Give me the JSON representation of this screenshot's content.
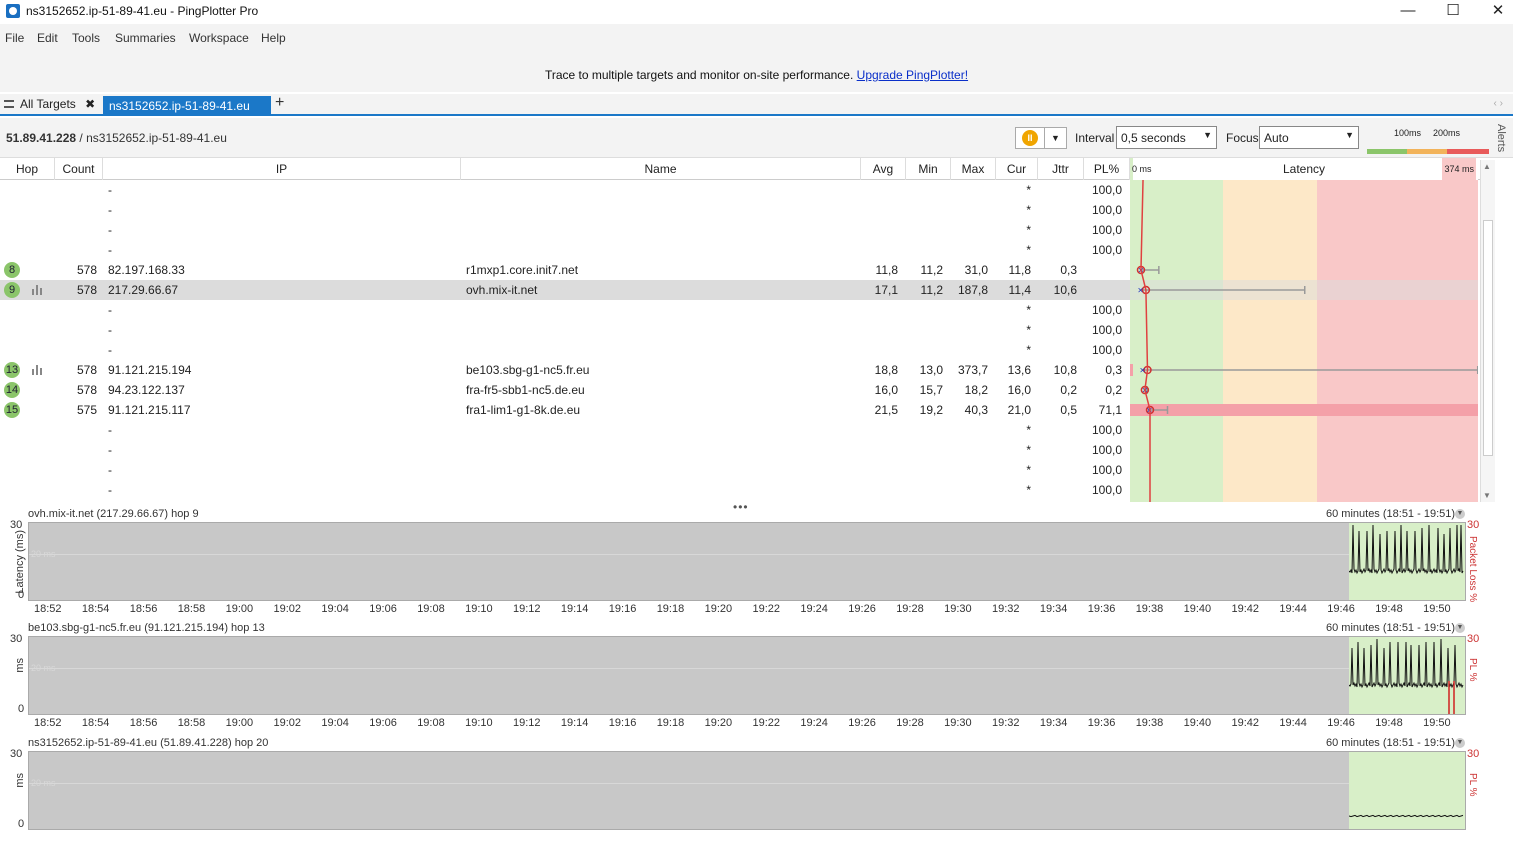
{
  "window": {
    "title": "ns3152652.ip-51-89-41.eu - PingPlotter Pro",
    "minimize": "—",
    "maximize": "☐",
    "close": "✕"
  },
  "menu": [
    "File",
    "Edit",
    "Tools",
    "Summaries",
    "Workspace",
    "Help"
  ],
  "banner": {
    "text": "Trace to multiple targets and monitor on-site performance.",
    "link": "Upgrade PingPlotter!"
  },
  "tabs": {
    "all": "All Targets",
    "active": "ns3152652.ip-51-89-41.eu",
    "add": "+"
  },
  "target": {
    "ip": "51.89.41.228",
    "host": "ns3152652.ip-51-89-41.eu",
    "interval_label": "Interval",
    "interval_value": "0,5 seconds",
    "focus_label": "Focus",
    "focus_value": "Auto",
    "scale_100": "100ms",
    "scale_200": "200ms",
    "alerts": "Alerts"
  },
  "table": {
    "headers": [
      "Hop",
      "Count",
      "IP",
      "Name",
      "Avg",
      "Min",
      "Max",
      "Cur",
      "Jttr",
      "PL%"
    ],
    "latency_header": "Latency",
    "lat_min": "0 ms",
    "lat_max": "374 ms",
    "rows": [
      {
        "hop": "",
        "count": "",
        "ip": "-",
        "name": "",
        "avg": "",
        "min": "",
        "max": "",
        "cur": "*",
        "jttr": "",
        "pl": "100,0"
      },
      {
        "hop": "",
        "count": "",
        "ip": "-",
        "name": "",
        "avg": "",
        "min": "",
        "max": "",
        "cur": "*",
        "jttr": "",
        "pl": "100,0"
      },
      {
        "hop": "",
        "count": "",
        "ip": "-",
        "name": "",
        "avg": "",
        "min": "",
        "max": "",
        "cur": "*",
        "jttr": "",
        "pl": "100,0"
      },
      {
        "hop": "",
        "count": "",
        "ip": "-",
        "name": "",
        "avg": "",
        "min": "",
        "max": "",
        "cur": "*",
        "jttr": "",
        "pl": "100,0"
      },
      {
        "hop": "8",
        "count": "578",
        "ip": "82.197.168.33",
        "name": "r1mxp1.core.init7.net",
        "avg": "11,8",
        "min": "11,2",
        "max": "31,0",
        "cur": "11,8",
        "jttr": "0,3",
        "pl": ""
      },
      {
        "hop": "9",
        "count": "578",
        "ip": "217.29.66.67",
        "name": "ovh.mix-it.net",
        "avg": "17,1",
        "min": "11,2",
        "max": "187,8",
        "cur": "11,4",
        "jttr": "10,6",
        "pl": ""
      },
      {
        "hop": "",
        "count": "",
        "ip": "-",
        "name": "",
        "avg": "",
        "min": "",
        "max": "",
        "cur": "*",
        "jttr": "",
        "pl": "100,0"
      },
      {
        "hop": "",
        "count": "",
        "ip": "-",
        "name": "",
        "avg": "",
        "min": "",
        "max": "",
        "cur": "*",
        "jttr": "",
        "pl": "100,0"
      },
      {
        "hop": "",
        "count": "",
        "ip": "-",
        "name": "",
        "avg": "",
        "min": "",
        "max": "",
        "cur": "*",
        "jttr": "",
        "pl": "100,0"
      },
      {
        "hop": "13",
        "count": "578",
        "ip": "91.121.215.194",
        "name": "be103.sbg-g1-nc5.fr.eu",
        "avg": "18,8",
        "min": "13,0",
        "max": "373,7",
        "cur": "13,6",
        "jttr": "10,8",
        "pl": "0,3"
      },
      {
        "hop": "14",
        "count": "578",
        "ip": "94.23.122.137",
        "name": "fra-fr5-sbb1-nc5.de.eu",
        "avg": "16,0",
        "min": "15,7",
        "max": "18,2",
        "cur": "16,0",
        "jttr": "0,2",
        "pl": "0,2"
      },
      {
        "hop": "15",
        "count": "575",
        "ip": "91.121.215.117",
        "name": "fra1-lim1-g1-8k.de.eu",
        "avg": "21,5",
        "min": "19,2",
        "max": "40,3",
        "cur": "21,0",
        "jttr": "0,5",
        "pl": "71,1"
      },
      {
        "hop": "",
        "count": "",
        "ip": "-",
        "name": "",
        "avg": "",
        "min": "",
        "max": "",
        "cur": "*",
        "jttr": "",
        "pl": "100,0"
      },
      {
        "hop": "",
        "count": "",
        "ip": "-",
        "name": "",
        "avg": "",
        "min": "",
        "max": "",
        "cur": "*",
        "jttr": "",
        "pl": "100,0"
      },
      {
        "hop": "",
        "count": "",
        "ip": "-",
        "name": "",
        "avg": "",
        "min": "",
        "max": "",
        "cur": "*",
        "jttr": "",
        "pl": "100,0"
      },
      {
        "hop": "",
        "count": "",
        "ip": "-",
        "name": "",
        "avg": "",
        "min": "",
        "max": "",
        "cur": "*",
        "jttr": "",
        "pl": "100,0"
      }
    ]
  },
  "graphs": [
    {
      "title": "ovh.mix-it.net (217.29.66.67) hop 9",
      "range": "60 minutes (18:51 - 19:51)",
      "ymax": "30",
      "ymin": "0",
      "yunit": "Latency (ms)",
      "grid": "20 ms",
      "rmax": "30",
      "runit": "Packet Loss %"
    },
    {
      "title": "be103.sbg-g1-nc5.fr.eu (91.121.215.194) hop 13",
      "range": "60 minutes (18:51 - 19:51)",
      "ymax": "30",
      "ymin": "0",
      "yunit": "ms",
      "grid": "20 ms",
      "rmax": "30",
      "runit": "PL %"
    },
    {
      "title": "ns3152652.ip-51-89-41.eu (51.89.41.228) hop 20",
      "range": "60 minutes (18:51 - 19:51)",
      "ymax": "30",
      "ymin": "0",
      "yunit": "ms",
      "grid": "20 ms",
      "rmax": "30",
      "runit": "PL %"
    }
  ],
  "xticks": [
    "18:52",
    "18:54",
    "18:56",
    "18:58",
    "19:00",
    "19:02",
    "19:04",
    "19:06",
    "19:08",
    "19:10",
    "19:12",
    "19:14",
    "19:16",
    "19:18",
    "19:20",
    "19:22",
    "19:24",
    "19:26",
    "19:28",
    "19:30",
    "19:32",
    "19:34",
    "19:36",
    "19:38",
    "19:40",
    "19:42",
    "19:44",
    "19:46",
    "19:48",
    "19:50"
  ],
  "colors": {
    "accent": "#1b78c8",
    "hop_badge": "#8bc56a",
    "lat_green": "#d8efc8",
    "lat_orange": "#fde8c8",
    "lat_red": "#f9c8c8",
    "pl_red": "#f4a0a8"
  }
}
